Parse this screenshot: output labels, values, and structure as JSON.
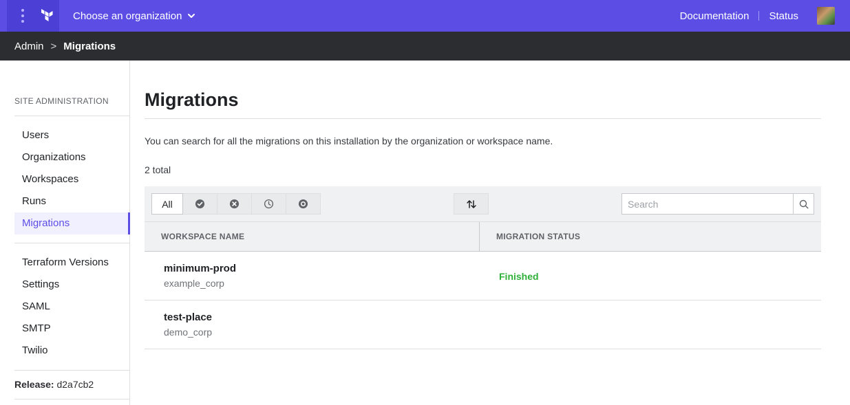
{
  "topbar": {
    "org_select_label": "Choose an organization",
    "links": [
      "Documentation",
      "Status"
    ],
    "brand_color": "#5c4ee5"
  },
  "breadcrumb": {
    "root": "Admin",
    "separator": ">",
    "current": "Migrations"
  },
  "sidebar": {
    "section_title": "SITE ADMINISTRATION",
    "items_primary": [
      "Users",
      "Organizations",
      "Workspaces",
      "Runs",
      "Migrations"
    ],
    "items_secondary": [
      "Terraform Versions",
      "Settings",
      "SAML",
      "SMTP",
      "Twilio"
    ],
    "active_item": "Migrations",
    "release_label": "Release:",
    "release_value": "d2a7cb2"
  },
  "main": {
    "title": "Migrations",
    "description": "You can search for all the migrations on this installation by the organization or workspace name.",
    "total": "2 total",
    "filters": {
      "all_label": "All",
      "icons": [
        "check-circle-icon",
        "x-circle-icon",
        "clock-icon",
        "target-circle-icon"
      ]
    },
    "sort_icon": "sort-arrows-icon",
    "search": {
      "placeholder": "Search"
    },
    "table": {
      "headers": [
        "WORKSPACE NAME",
        "MIGRATION STATUS"
      ],
      "rows": [
        {
          "workspace": "minimum-prod",
          "organization": "example_corp",
          "status": "Finished"
        },
        {
          "workspace": "test-place",
          "organization": "demo_corp",
          "status": ""
        }
      ]
    },
    "status_color": "#2eb039"
  }
}
